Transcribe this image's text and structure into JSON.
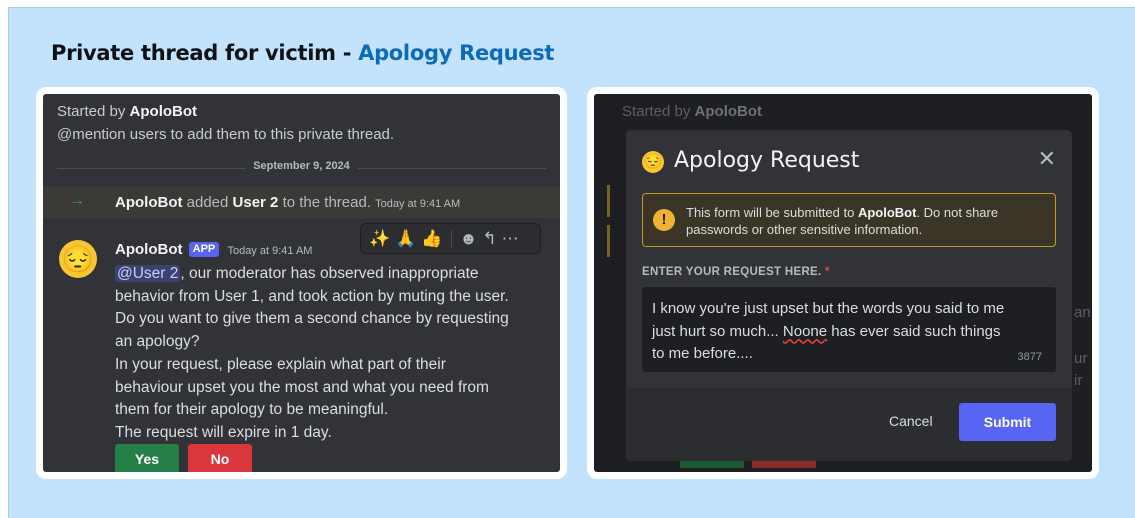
{
  "page": {
    "title_prefix": "Private thread for victim - ",
    "title_accent": "Apology Request"
  },
  "left": {
    "started_prefix": "Started by ",
    "started_bot": "ApoloBot",
    "hint": "@mention users to add them to this private thread.",
    "date": "September 9, 2024",
    "added": {
      "bot": "ApoloBot",
      "mid1": " added ",
      "user": "User 2",
      "mid2": " to the thread. ",
      "time": "Today at 9:41 AM"
    },
    "message": {
      "author": "ApoloBot",
      "badge": "APP",
      "time": "Today at 9:41 AM",
      "mention": "@User 2",
      "line1_rest": ", our moderator has observed inappropriate",
      "line2": "behavior from User 1, and took action by muting the user.",
      "line3": "Do you want to give them a second chance by requesting",
      "line4": "an apology?",
      "line5": "In your request, please explain what part of their",
      "line6": "behaviour upset you the most and what you need from",
      "line7": "them for their apology to be meaningful.",
      "line8": "The request will expire in 1 day."
    },
    "reactions": {
      "r1": "✨",
      "r2": "🙏",
      "r3": "👍",
      "emoji": "☻",
      "reply": "↰",
      "more": "⋯"
    },
    "avatar_emoji": "😔",
    "yes_label": "Yes",
    "no_label": "No"
  },
  "right": {
    "started_prefix": "Started by ",
    "started_bot": "ApoloBot",
    "ghost_an": "an",
    "ghost_ur": "ur",
    "ghost_ir": "ir",
    "modal": {
      "emoji": "😔",
      "title": "Apology Request",
      "close": "✕",
      "warn_icon": "!",
      "warn_prefix": "This form will be submitted to ",
      "warn_bot": "ApoloBot",
      "warn_suffix": ". Do not share passwords or other sensitive information.",
      "field_label": "ENTER YOUR REQUEST HERE.",
      "required_mark": "*",
      "value_line1": "I know you're just upset but the words you said to me",
      "value_line2a": "just hurt so much... ",
      "value_misspelled": "Noone",
      "value_line2b": " has ever said such things",
      "value_line3": "to me before....",
      "counter": "3877",
      "cancel": "Cancel",
      "submit": "Submit"
    }
  },
  "colors": {
    "background": "#c2e3fb",
    "accent_title": "#0d6bb7",
    "discord_blurple": "#5865f2",
    "yes_green": "#248046",
    "no_red": "#da373c",
    "warning_border": "#c49a22"
  }
}
